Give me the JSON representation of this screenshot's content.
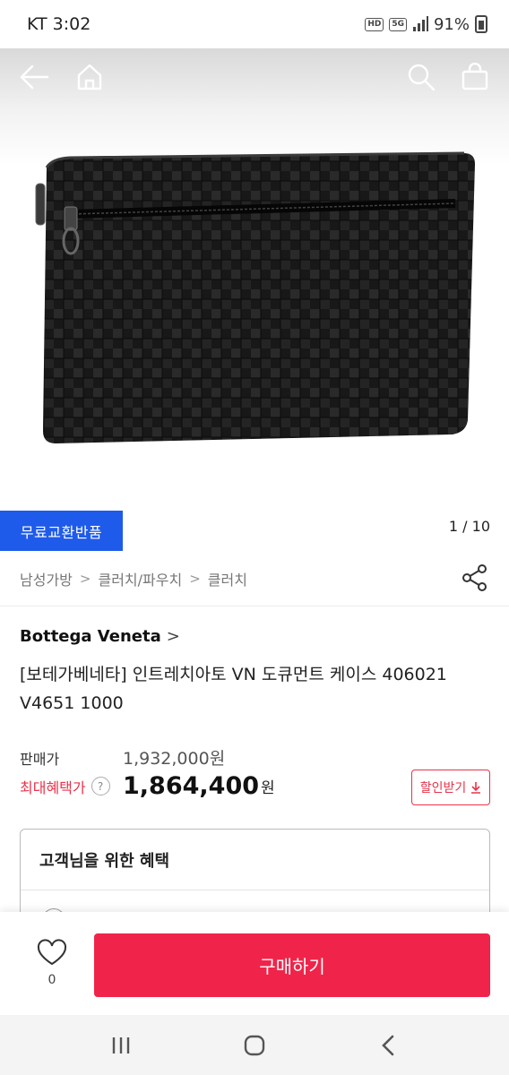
{
  "status_bar": {
    "carrier_time": "KT 3:02",
    "hd_tag": "HD",
    "network_tag": "5G",
    "battery_percent": "91%"
  },
  "hero": {
    "icons": [
      "back-arrow-icon",
      "home-icon",
      "search-icon",
      "shopping-bag-icon"
    ],
    "badge_label": "무료교환반품",
    "pager": "1 / 10"
  },
  "breadcrumb": {
    "items": [
      "남성가방",
      "클러치/파우치",
      "클러치"
    ],
    "separator": ">",
    "share_icon": "share-icon"
  },
  "product": {
    "brand": "Bottega Veneta",
    "brand_arrow": ">",
    "title": "[보테가베네타] 인트레치아토 VN 도큐먼트 케이스 406021 V4651 1000"
  },
  "pricing": {
    "sale_label": "판매가",
    "sale_price": "1,932,000원",
    "max_benefit_label": "최대혜택가",
    "help_mark": "?",
    "max_benefit_price": "1,864,400",
    "max_benefit_unit": "원",
    "coupon_label": "할인받기"
  },
  "benefits": {
    "title": "고객님을 위한 혜택"
  },
  "buy_bar": {
    "like_count": "0",
    "buy_label": "구매하기"
  },
  "colors": {
    "badge_blue": "#1f5bea",
    "accent_red": "#f0244a",
    "benefit_red": "#e8334a"
  }
}
